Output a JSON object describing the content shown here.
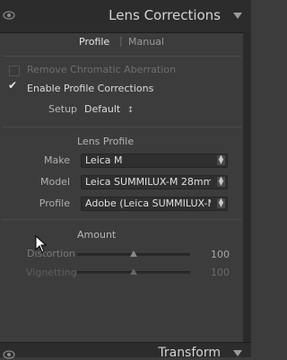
{
  "header": {
    "title": "Lens Corrections"
  },
  "tabs": {
    "profile": "Profile",
    "separator": "|",
    "manual": "Manual"
  },
  "options": {
    "remove_ca_label": "Remove Chromatic Aberration",
    "remove_ca_checked": false,
    "enable_profile_label": "Enable Profile Corrections",
    "enable_profile_checked": true,
    "setup_label": "Setup",
    "setup_value": "Default",
    "updown_glyph": "↕"
  },
  "lens_profile": {
    "title": "Lens Profile",
    "make_label": "Make",
    "make_value": "Leica M",
    "model_label": "Model",
    "model_value": "Leica SUMMILUX-M 28mm ...",
    "profile_label": "Profile",
    "profile_value": "Adobe (Leica SUMMILUX-M..."
  },
  "amount": {
    "title": "Amount",
    "distortion_label": "Distortion",
    "distortion_value": "100",
    "vignetting_label": "Vignetting",
    "vignetting_value": "100"
  },
  "bottom_header": {
    "title": "Transform"
  },
  "colors": {
    "panel_bg": "#3c3c3c",
    "header_bg": "#2c2c2c",
    "field_bg": "#2f2f2f"
  }
}
